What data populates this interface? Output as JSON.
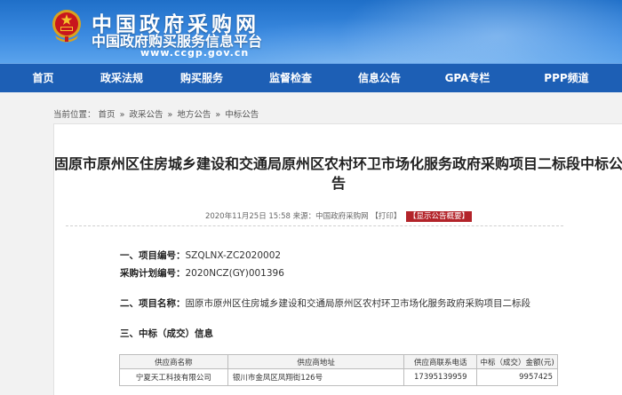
{
  "header": {
    "site_name": "中国政府采购网",
    "site_subtitle": "中国政府购买服务信息平台",
    "site_url": "www.ccgp.gov.cn"
  },
  "nav": {
    "items": [
      "首页",
      "政采法规",
      "购买服务",
      "监督检查",
      "信息公告",
      "GPA专栏",
      "PPP频道"
    ]
  },
  "breadcrumb": {
    "prefix": "当前位置：",
    "items": [
      "首页",
      "政采公告",
      "地方公告",
      "中标公告"
    ],
    "separator": "»"
  },
  "article": {
    "title": "固原市原州区住房城乡建设和交通局原州区农村环卫市场化服务政府采购项目二标段中标公告",
    "meta": "2020年11月25日 15:58 来源：中国政府采购网",
    "print_label": "【打印】",
    "summary_button": "【显示公告概要】",
    "project_no_label": "一、项目编号：",
    "project_no_value": "SZQLNX-ZC2020002",
    "plan_no_label": "采购计划编号：",
    "plan_no_value": "2020NCZ(GY)001396",
    "project_name_label": "二、项目名称：",
    "project_name_value": "固原市原州区住房城乡建设和交通局原州区农村环卫市场化服务政府采购项目二标段",
    "result_heading": "三、中标（成交）信息"
  },
  "result_table": {
    "headers": [
      "供应商名称",
      "供应商地址",
      "供应商联系电话",
      "中标（成交）金额(元)"
    ],
    "rows": [
      [
        "宁夏天工科技有限公司",
        "银川市金凤区凤翔街126号",
        "17395139959",
        "9957425"
      ]
    ]
  },
  "colors": {
    "banner": "#2a7fd6",
    "nav": "#1d5fb5",
    "badge": "#b3242a"
  }
}
